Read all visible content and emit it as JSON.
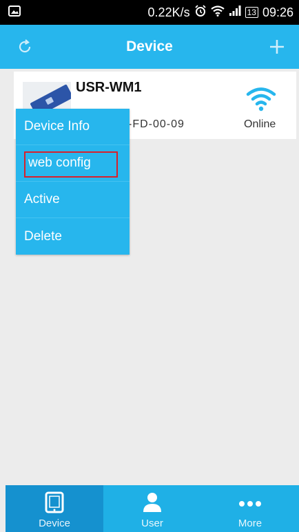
{
  "status_bar": {
    "left_icon": "image-icon",
    "speed": "0.22K/s",
    "battery": "13",
    "time": "09:26"
  },
  "header": {
    "title": "Device",
    "left_icon": "refresh-icon",
    "right_icon": "plus-icon"
  },
  "device": {
    "name": "USR-WM1",
    "mac_partial": "-FD-00-09",
    "status": "Online"
  },
  "context_menu": {
    "items": [
      {
        "label": "Device Info"
      },
      {
        "label": "web config",
        "highlighted": true
      },
      {
        "label": "Active"
      },
      {
        "label": "Delete"
      }
    ]
  },
  "tab_bar": {
    "tabs": [
      {
        "label": "Device",
        "icon": "tablet-icon",
        "active": true
      },
      {
        "label": "User",
        "icon": "user-icon",
        "active": false
      },
      {
        "label": "More",
        "icon": "more-icon",
        "active": false
      }
    ]
  },
  "colors": {
    "primary": "#27b6ed",
    "active_tab": "#1591cf",
    "highlight_border": "#d91f2a",
    "background": "#ececec"
  }
}
